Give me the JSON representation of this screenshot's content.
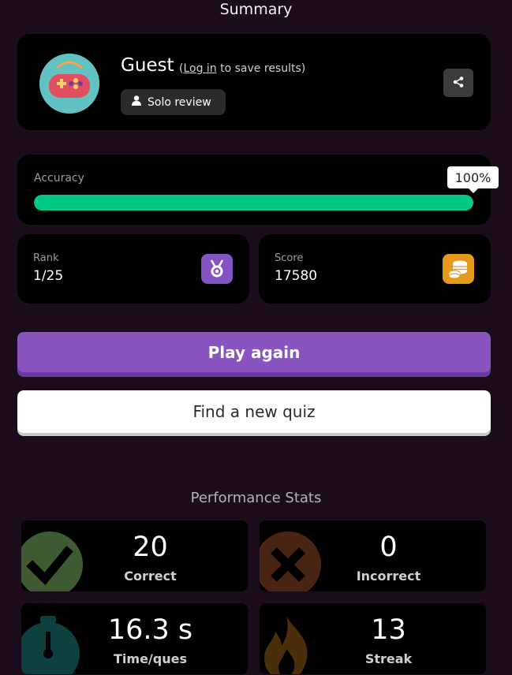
{
  "header": {
    "title": "Summary"
  },
  "profile": {
    "name": "Guest",
    "login_open": "(",
    "login_link": "Log in",
    "login_rest": " to save results)",
    "mode": "Solo review",
    "avatar_icon": "gamepad-icon",
    "share_icon": "share-icon"
  },
  "accuracy": {
    "label": "Accuracy",
    "percent": 100,
    "percent_label": "100%",
    "color": "#00c985"
  },
  "rank": {
    "label": "Rank",
    "value": "1/25",
    "icon": "medal-icon",
    "color": "#8454c4"
  },
  "score": {
    "label": "Score",
    "value": "17580",
    "icon": "coins-icon",
    "color": "#e59a1c"
  },
  "actions": {
    "play_again": "Play again",
    "find_quiz": "Find a new quiz"
  },
  "performance": {
    "title": "Performance Stats",
    "tiles": [
      {
        "value": "20",
        "label": "Correct",
        "icon": "checkmark-icon",
        "color": "#3e5a32"
      },
      {
        "value": "0",
        "label": "Incorrect",
        "icon": "x-icon",
        "color": "#4a2412"
      },
      {
        "value": "16.3 s",
        "label": "Time/ques",
        "icon": "stopwatch-icon",
        "color": "#0f4040"
      },
      {
        "value": "13",
        "label": "Streak",
        "icon": "flame-icon",
        "color": "#4a2e0a"
      }
    ]
  }
}
